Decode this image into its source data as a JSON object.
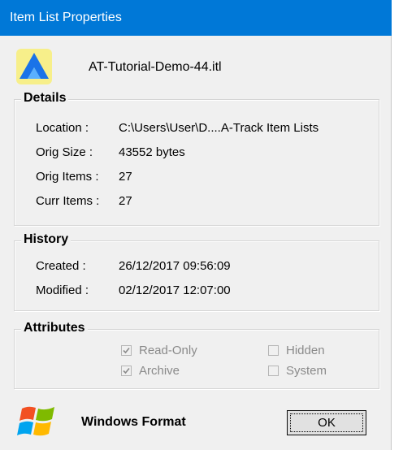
{
  "window": {
    "title": "Item List Properties"
  },
  "file": {
    "name": "AT-Tutorial-Demo-44.itl",
    "icon": "a-track-app-icon"
  },
  "details": {
    "title": "Details",
    "rows": [
      {
        "label": "Location :",
        "value": "C:\\Users\\User\\D....A-Track Item Lists"
      },
      {
        "label": "Orig Size :",
        "value": "43552 bytes"
      },
      {
        "label": "Orig Items :",
        "value": "27"
      },
      {
        "label": "Curr Items :",
        "value": "27"
      }
    ]
  },
  "history": {
    "title": "History",
    "rows": [
      {
        "label": "Created :",
        "value": "26/12/2017 09:56:09"
      },
      {
        "label": "Modified :",
        "value": "02/12/2017 12:07:00"
      }
    ]
  },
  "attributes": {
    "title": "Attributes",
    "items": [
      {
        "label": "Read-Only",
        "checked": true
      },
      {
        "label": "Hidden",
        "checked": false
      },
      {
        "label": "Archive",
        "checked": true
      },
      {
        "label": "System",
        "checked": false
      }
    ]
  },
  "footer": {
    "format_label": "Windows Format",
    "format_icon": "windows-logo-icon",
    "ok_label": "OK"
  },
  "colors": {
    "titlebar": "#0078d7",
    "dialog_bg": "#f0f0f0",
    "disabled_text": "#8a8a8a"
  }
}
